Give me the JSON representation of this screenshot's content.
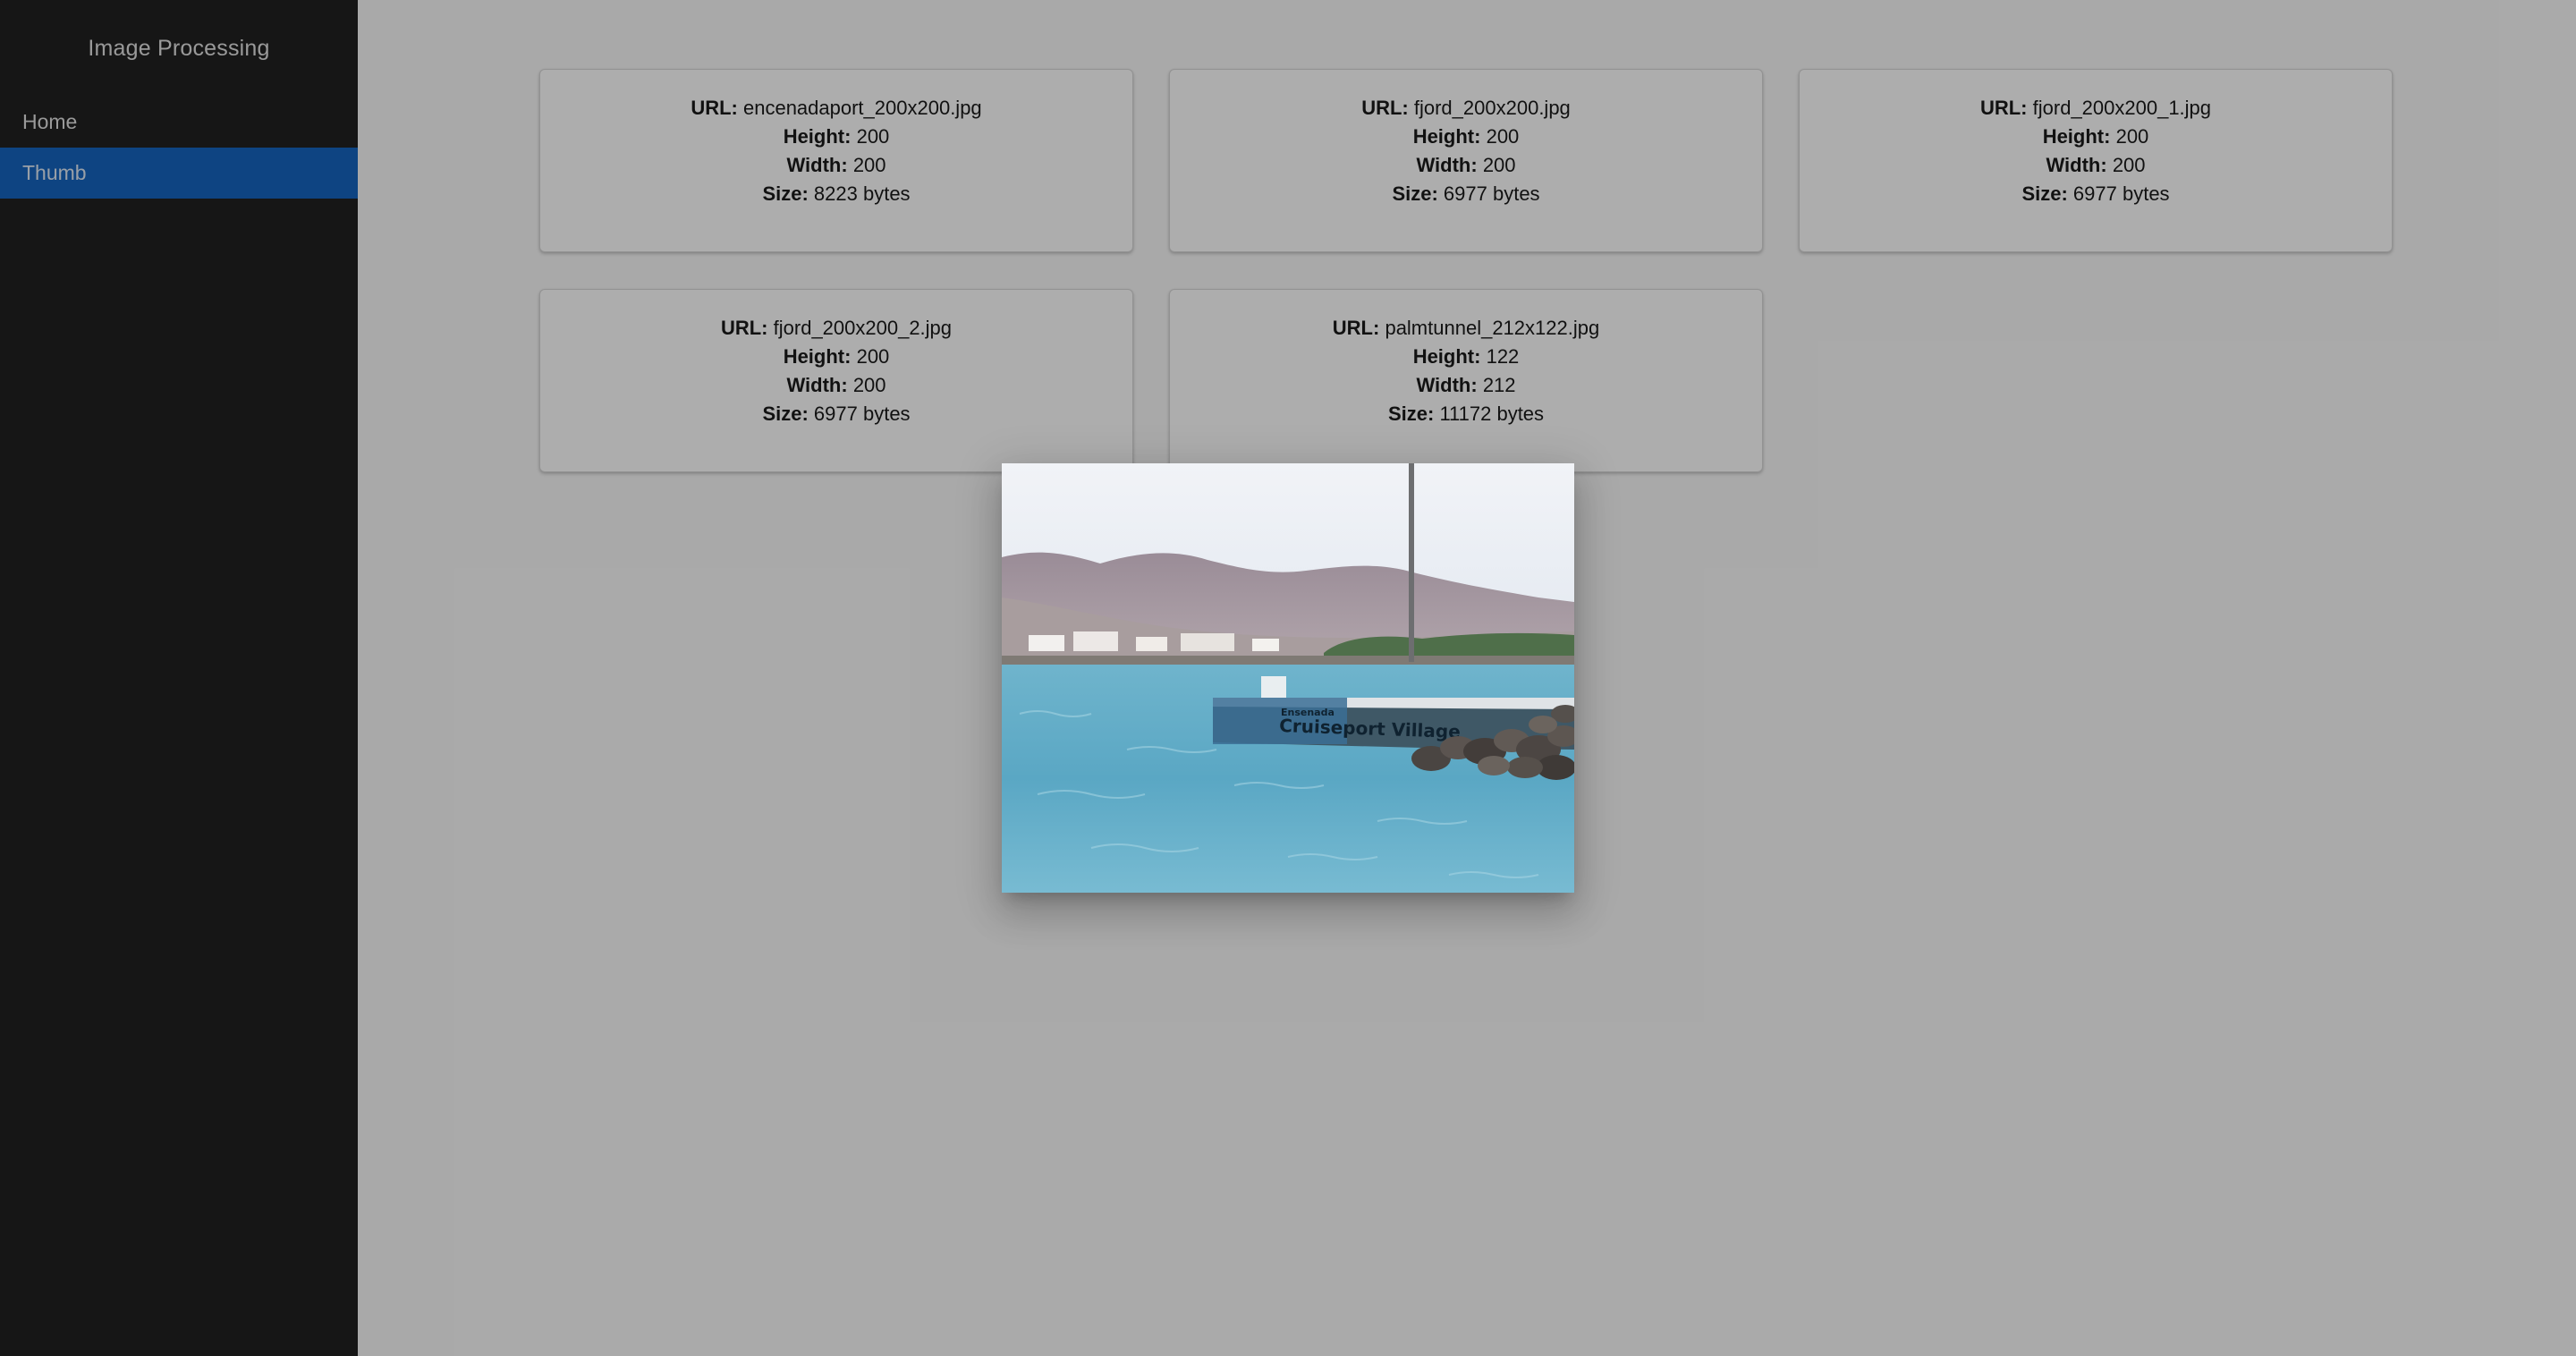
{
  "app": {
    "title": "Image Processing"
  },
  "nav": {
    "items": [
      {
        "label": "Home",
        "active": false
      },
      {
        "label": "Thumb",
        "active": true
      }
    ]
  },
  "labels": {
    "url": "URL:",
    "height": "Height:",
    "width": "Width:",
    "size": "Size:"
  },
  "cards": [
    {
      "url": "encenadaport_200x200.jpg",
      "height": "200",
      "width": "200",
      "size": "8223 bytes"
    },
    {
      "url": "fjord_200x200.jpg",
      "height": "200",
      "width": "200",
      "size": "6977 bytes"
    },
    {
      "url": "fjord_200x200_1.jpg",
      "height": "200",
      "width": "200",
      "size": "6977 bytes"
    },
    {
      "url": "fjord_200x200_2.jpg",
      "height": "200",
      "width": "200",
      "size": "6977 bytes"
    },
    {
      "url": "palmtunnel_212x122.jpg",
      "height": "122",
      "width": "212",
      "size": "11172 bytes"
    }
  ],
  "dialog": {
    "sign_text_top": "Ensenada",
    "sign_text_main": "Cruiseport Village"
  },
  "colors": {
    "sidebar_bg": "#212121",
    "active_item_bg": "#1565c0",
    "backdrop": "rgba(0,0,0,0.32)"
  }
}
